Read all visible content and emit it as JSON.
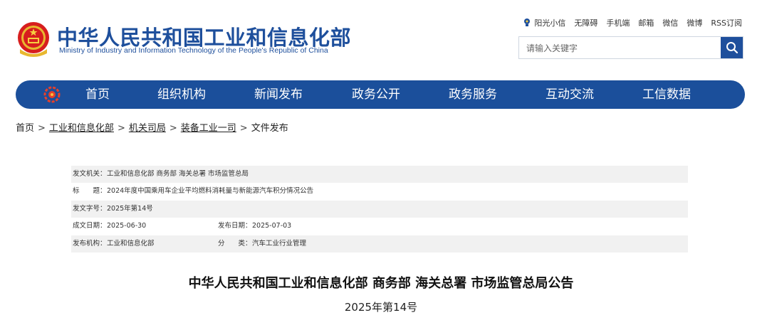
{
  "header": {
    "site_title": "中华人民共和国工业和信息化部",
    "site_subtitle": "Ministry of Industry and Information Technology of the People's Republic of China",
    "top_links": [
      "阳光小信",
      "无障碍",
      "手机端",
      "邮箱",
      "微信",
      "微博",
      "RSS订阅"
    ],
    "search_placeholder": "请输入关键字",
    "brand_color": "#1b4f9b"
  },
  "nav": {
    "items": [
      "首页",
      "组织机构",
      "新闻发布",
      "政务公开",
      "政务服务",
      "互动交流",
      "工信数据"
    ]
  },
  "breadcrumb": {
    "items": [
      "首页",
      "工业和信息化部",
      "机关司局",
      "装备工业一司",
      "文件发布"
    ],
    "separator": ">"
  },
  "meta": {
    "issuer_label": "发文机关：",
    "issuer": "工业和信息化部 商务部 海关总署 市场监管总局",
    "title_label": "标　　题：",
    "title": "2024年度中国乘用车企业平均燃料消耗量与新能源汽车积分情况公告",
    "docno_label": "发文字号：",
    "docno": "2025年第14号",
    "created_label": "成文日期：",
    "created": "2025-06-30",
    "published_label": "发布日期：",
    "published": "2025-07-03",
    "org_label": "发布机构：",
    "org": "工业和信息化部",
    "category_label": "分　　类：",
    "category": "汽车工业行业管理"
  },
  "document": {
    "title": "中华人民共和国工业和信息化部 商务部 海关总署 市场监管总局公告",
    "number": "2025年第14号"
  }
}
